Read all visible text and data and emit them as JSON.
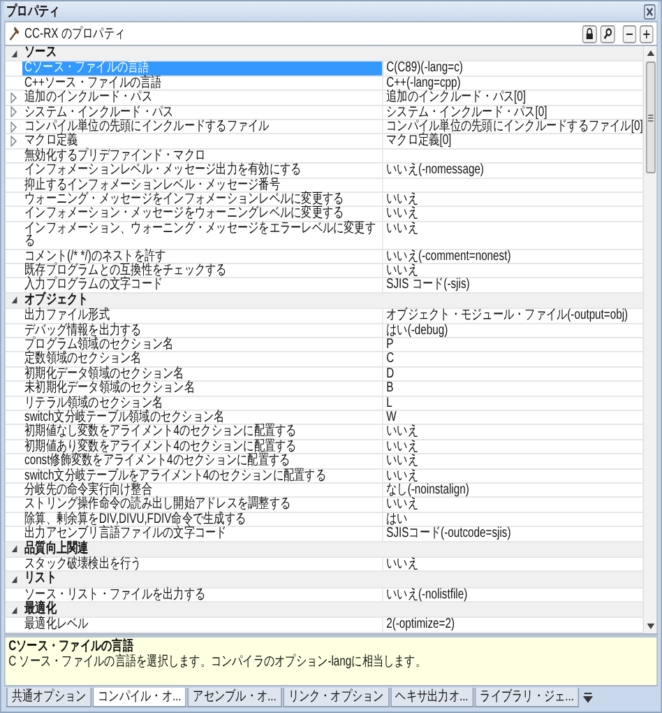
{
  "window": {
    "title": "プロパティ"
  },
  "toolbar": {
    "title": "CC-RX のプロパティ"
  },
  "sections": [
    {
      "name": "ソース",
      "expanded": true,
      "rows": [
        {
          "name": "Cソース・ファイルの言語",
          "value": "C(C89)(-lang=c)",
          "kind": "plain",
          "selected": true
        },
        {
          "name": "C++ソース・ファイルの言語",
          "value": "C++(-lang=cpp)",
          "kind": "plain",
          "selected": false
        },
        {
          "name": "追加のインクルード・パス",
          "value": "追加のインクルード・パス[0]",
          "kind": "expandable",
          "selected": false
        },
        {
          "name": "システム・インクルード・パス",
          "value": "システム・インクルード・パス[0]",
          "kind": "expandable",
          "selected": false
        },
        {
          "name": "コンパイル単位の先頭にインクルードするファイル",
          "value": "コンパイル単位の先頭にインクルードするファイル[0]",
          "kind": "expandable",
          "selected": false
        },
        {
          "name": "マクロ定義",
          "value": "マクロ定義[0]",
          "kind": "expandable",
          "selected": false
        },
        {
          "name": "無効化するプリデファインド・マクロ",
          "kind": "plain",
          "selected": false
        },
        {
          "name": "インフォメーションレベル・メッセージ出力を有効にする",
          "value": "いいえ(-nomessage)",
          "kind": "plain",
          "selected": false
        },
        {
          "name": "抑止するインフォメーションレベル・メッセージ番号",
          "kind": "plain",
          "selected": false
        },
        {
          "name": "ウォーニング・メッセージをインフォメーションレベルに変更する",
          "value": "いいえ",
          "kind": "plain",
          "selected": false
        },
        {
          "name": "インフォメーション・メッセージをウォーニングレベルに変更する",
          "value": "いいえ",
          "kind": "plain",
          "selected": false
        },
        {
          "name": "インフォメーション、ウォーニング・メッセージをエラーレベルに変更する",
          "value": "いいえ",
          "kind": "plain",
          "selected": false
        },
        {
          "name": "コメント(/* */)のネストを許す",
          "value": "いいえ(-comment=nonest)",
          "kind": "plain",
          "selected": false
        },
        {
          "name": "既存プログラムとの互換性をチェックする",
          "value": "いいえ",
          "kind": "plain",
          "selected": false
        },
        {
          "name": "入力プログラムの文字コード",
          "value": "SJIS コード(-sjis)",
          "kind": "plain",
          "selected": false
        }
      ]
    },
    {
      "name": "オブジェクト",
      "expanded": true,
      "rows": [
        {
          "name": "出力ファイル形式",
          "value": "オブジェクト・モジュール・ファイル(-output=obj)",
          "kind": "plain",
          "selected": false
        },
        {
          "name": "デバッグ情報を出力する",
          "value": "はい(-debug)",
          "kind": "plain",
          "selected": false
        },
        {
          "name": "プログラム領域のセクション名",
          "value": "P",
          "kind": "plain",
          "selected": false
        },
        {
          "name": "定数領域のセクション名",
          "value": "C",
          "kind": "plain",
          "selected": false
        },
        {
          "name": "初期化データ領域のセクション名",
          "value": "D",
          "kind": "plain",
          "selected": false
        },
        {
          "name": "未初期化データ領域のセクション名",
          "value": "B",
          "kind": "plain",
          "selected": false
        },
        {
          "name": "リテラル領域のセクション名",
          "value": "L",
          "kind": "plain",
          "selected": false
        },
        {
          "name": "switch文分岐テーブル領域のセクション名",
          "value": "W",
          "kind": "plain",
          "selected": false
        },
        {
          "name": "初期値なし変数をアライメント4のセクションに配置する",
          "value": "いいえ",
          "kind": "plain",
          "selected": false
        },
        {
          "name": "初期値あり変数をアライメント4のセクションに配置する",
          "value": "いいえ",
          "kind": "plain",
          "selected": false
        },
        {
          "name": "const修飾変数をアライメント4のセクションに配置する",
          "value": "いいえ",
          "kind": "plain",
          "selected": false
        },
        {
          "name": "switch文分岐テーブルをアライメント4のセクションに配置する",
          "value": "いいえ",
          "kind": "plain",
          "selected": false
        },
        {
          "name": "分岐先の命令実行向け整合",
          "value": "なし(-noinstalign)",
          "kind": "plain",
          "selected": false
        },
        {
          "name": "ストリング操作命令の読み出し開始アドレスを調整する",
          "value": "いいえ",
          "kind": "plain",
          "selected": false
        },
        {
          "name": "除算、剰余算をDIV,DIVU,FDIV命令で生成する",
          "value": "はい",
          "kind": "plain",
          "selected": false
        },
        {
          "name": "出力アセンブリ言語ファイルの文字コード",
          "value": "SJISコード(-outcode=sjis)",
          "kind": "plain",
          "selected": false
        }
      ]
    },
    {
      "name": "品質向上関連",
      "expanded": true,
      "rows": [
        {
          "name": "スタック破壊検出を行う",
          "value": "いいえ",
          "kind": "plain",
          "selected": false
        }
      ]
    },
    {
      "name": "リスト",
      "expanded": true,
      "rows": [
        {
          "name": "ソース・リスト・ファイルを出力する",
          "value": "いいえ(-nolistfile)",
          "kind": "plain",
          "selected": false
        }
      ]
    },
    {
      "name": "最適化",
      "expanded": true,
      "rows": [
        {
          "name": "最適化レベル",
          "value": "2(-optimize=2)",
          "kind": "plain",
          "selected": false
        }
      ]
    }
  ],
  "description": {
    "title": "Cソース・ファイルの言語",
    "text": "C ソース・ファイルの言語を選択します。コンパイラのオプション-langに相当します。"
  },
  "tabs": [
    {
      "label": "共通オプション",
      "selected": false
    },
    {
      "label": "コンパイル・オ...",
      "selected": true
    },
    {
      "label": "アセンブル・オ...",
      "selected": false
    },
    {
      "label": "リンク・オプション",
      "selected": false
    },
    {
      "label": "ヘキサ出力オ...",
      "selected": false
    },
    {
      "label": "ライブラリ・ジェ...",
      "selected": false
    }
  ]
}
